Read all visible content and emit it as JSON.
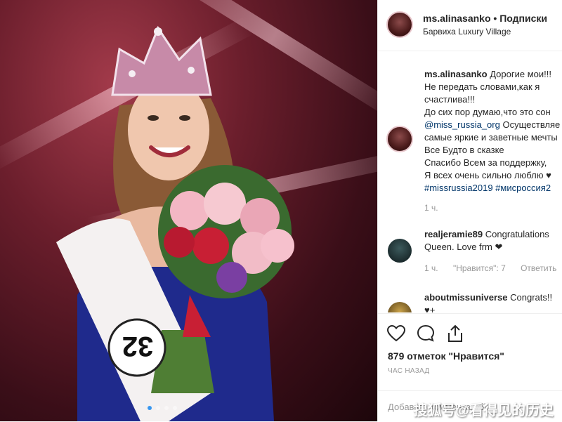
{
  "header": {
    "username": "ms.alinasanko",
    "separator": "•",
    "follow_label": "Подписки",
    "location": "Барвиха Luxury Village"
  },
  "caption": {
    "username": "ms.alinasanko",
    "lines": [
      "Дорогие мои!!!",
      "Не передать словами,как я",
      "счастлива!!!",
      "До сих пор думаю,что это сон",
      "Осуществляе",
      "самые яркие и заветные мечты",
      "Все Будто в сказке",
      "Спасибо Всем за поддержку,",
      "Я всех очень сильно люблю ♥",
      "#missrussia2019 #мисроссия2"
    ],
    "mention": "@miss_russia_org",
    "time": "1 ч."
  },
  "comments": [
    {
      "username": "realjeramie89",
      "text_line1": "Congratulations",
      "text_line2": "Queen. Love frm",
      "time": "1 ч.",
      "likes": "\"Нравится\": 7",
      "reply": "Ответить"
    },
    {
      "username": "aboutmissuniverse",
      "text_line1": "Congrats!!",
      "text_line2": "♥+"
    }
  ],
  "actions": {
    "icons": [
      "heart-icon",
      "comment-icon",
      "share-icon"
    ],
    "likes_text": "879 отметок \"Нравится\"",
    "posted_ago": "ЧАС НАЗАД"
  },
  "add_comment": {
    "placeholder": "Добавьте комментарий..."
  },
  "watermark": "搜狐号@看得见的历史",
  "photo": {
    "sash_number": "32",
    "carousel_dots": 4,
    "active_dot": 0
  }
}
